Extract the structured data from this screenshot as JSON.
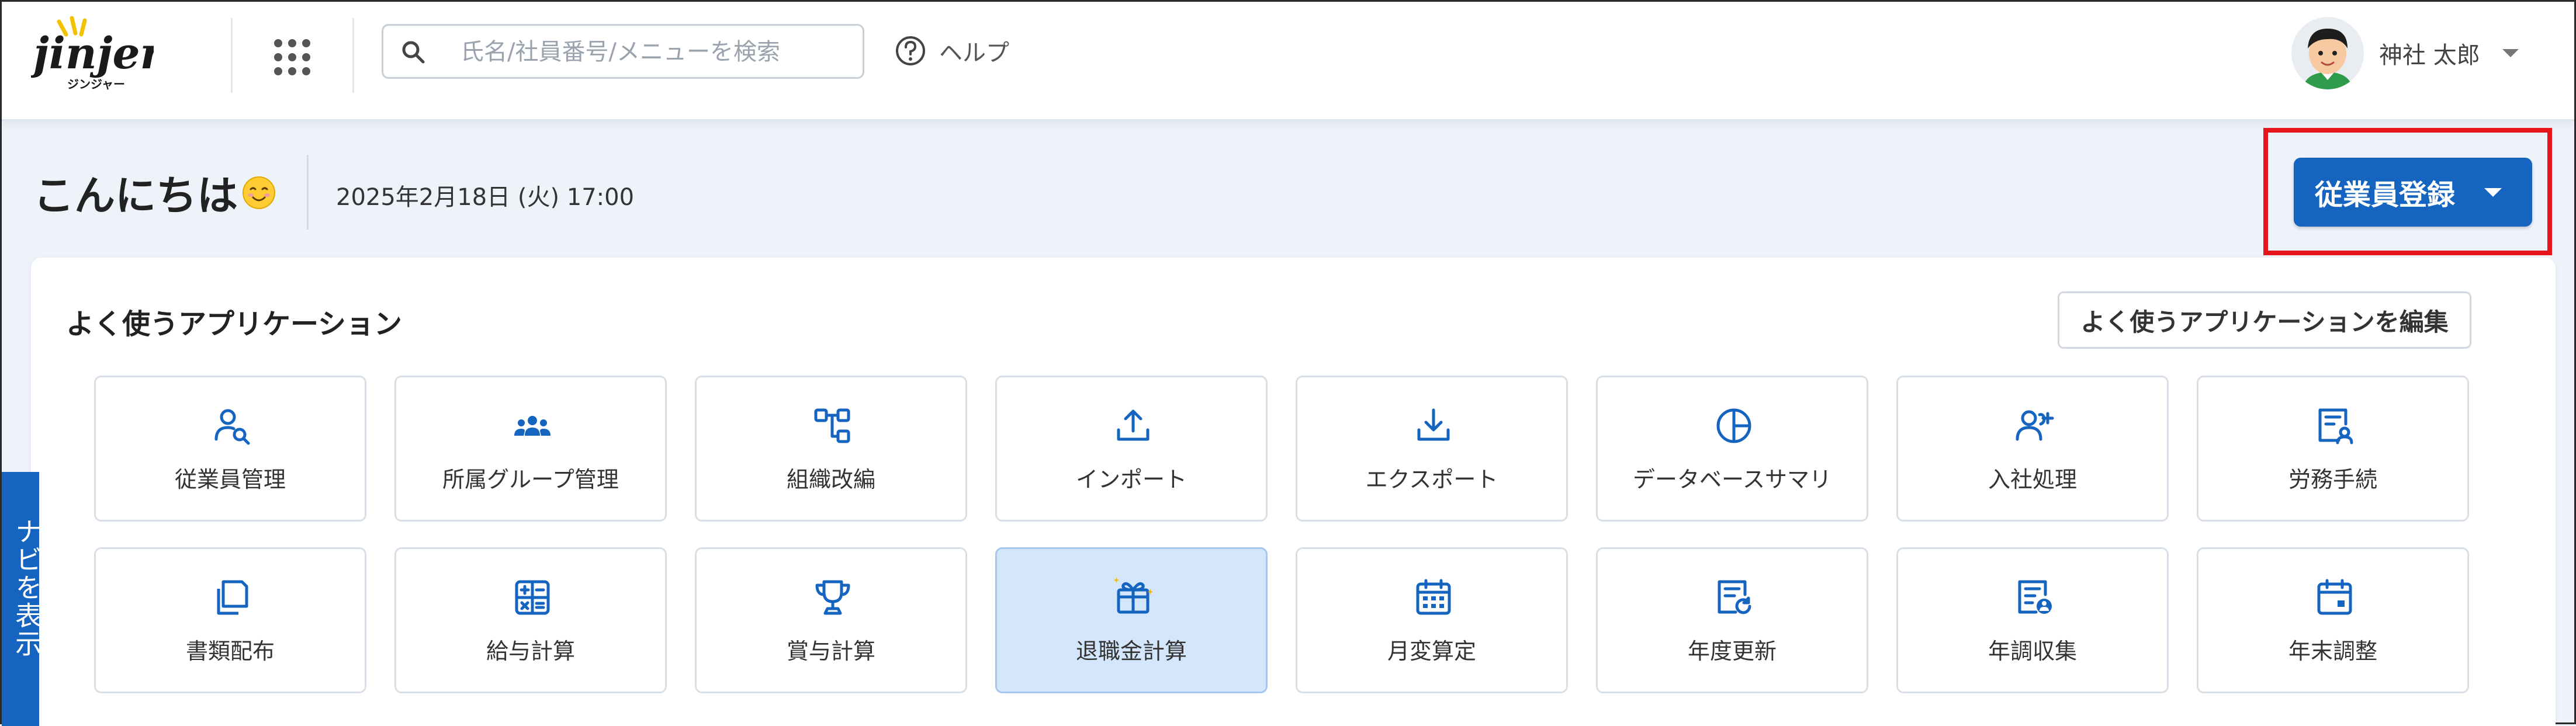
{
  "header": {
    "logo_text": "jinjer",
    "logo_subtext": "ジンジャー",
    "search": {
      "placeholder": "氏名/社員番号/メニューを検索",
      "value": ""
    },
    "help_label": "ヘルプ",
    "user_name": "神社 太郎"
  },
  "greeting": {
    "text": "こんにちは",
    "datetime": "2025年2月18日 (火) 17:00"
  },
  "register_button": {
    "label": "従業員登録"
  },
  "apps": {
    "title": "よく使うアプリケーション",
    "edit_label": "よく使うアプリケーションを編集",
    "items": [
      {
        "label": "従業員管理",
        "icon": "employee-search-icon"
      },
      {
        "label": "所属グループ管理",
        "icon": "group-icon"
      },
      {
        "label": "組織改編",
        "icon": "org-chart-icon"
      },
      {
        "label": "インポート",
        "icon": "upload-icon"
      },
      {
        "label": "エクスポート",
        "icon": "download-icon"
      },
      {
        "label": "データベースサマリ",
        "icon": "pie-chart-icon"
      },
      {
        "label": "入社処理",
        "icon": "add-user-icon"
      },
      {
        "label": "労務手続",
        "icon": "labor-document-icon"
      },
      {
        "label": "書類配布",
        "icon": "documents-icon"
      },
      {
        "label": "給与計算",
        "icon": "calculator-icon"
      },
      {
        "label": "賞与計算",
        "icon": "trophy-icon"
      },
      {
        "label": "退職金計算",
        "icon": "gift-icon"
      },
      {
        "label": "月変算定",
        "icon": "calendar-grid-icon"
      },
      {
        "label": "年度更新",
        "icon": "document-refresh-icon"
      },
      {
        "label": "年調収集",
        "icon": "document-user-icon"
      },
      {
        "label": "年末調整",
        "icon": "calendar-icon"
      }
    ]
  },
  "nav_tab_label": "ナビを表示",
  "colors": {
    "primary": "#1565c0",
    "highlight": "#e8141c",
    "active_tile": "#d4e6fb"
  }
}
